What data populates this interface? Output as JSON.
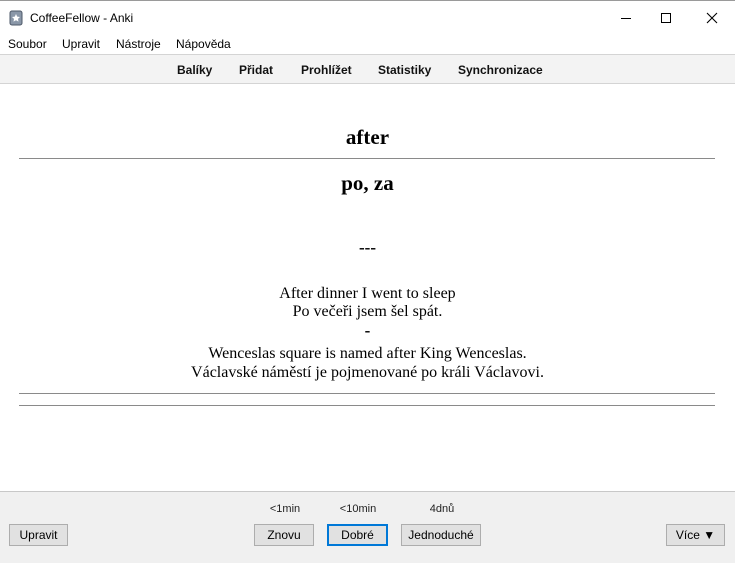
{
  "window": {
    "title": "CoffeeFellow - Anki"
  },
  "menubar": {
    "items": [
      "Soubor",
      "Upravit",
      "Nástroje",
      "Nápověda"
    ]
  },
  "toolbar": {
    "items": [
      "Balíky",
      "Přidat",
      "Prohlížet",
      "Statistiky",
      "Synchronizace"
    ]
  },
  "card": {
    "front": "after",
    "back": "po, za",
    "separator": "---",
    "example1_en": "After dinner I went to sleep",
    "example1_cs": "Po večeři jsem šel spát.",
    "dash": "-",
    "example2_en": "Wenceslas square is named after King Wenceslas.",
    "example2_cs": "Václavské náměstí je pojmenované po králi Václavovi."
  },
  "bottom": {
    "edit_label": "Upravit",
    "intervals": [
      "<1min",
      "<10min",
      "4dnů"
    ],
    "answers": [
      "Znovu",
      "Dobré",
      "Jednoduché"
    ],
    "more_label": "Více ▼"
  },
  "colors": {
    "default_button_border": "#0078d7",
    "toolbar_bg": "#f3f3f3",
    "bottom_bg": "#f0f0f0"
  }
}
